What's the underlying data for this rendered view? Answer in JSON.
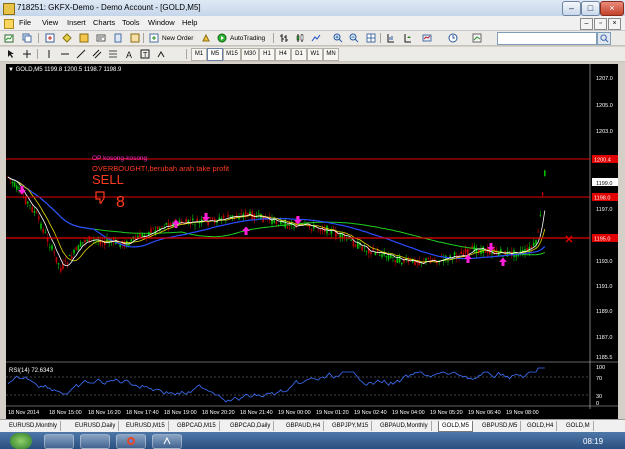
{
  "window": {
    "title": "718251: GKFX-Demo - Demo Account - [GOLD,M5]",
    "min": "–",
    "max": "□",
    "close": "×"
  },
  "menu": {
    "items": [
      "File",
      "View",
      "Insert",
      "Charts",
      "Tools",
      "Window",
      "Help"
    ],
    "mdi_min": "–",
    "mdi_restore": "▫",
    "mdi_close": "×"
  },
  "toolbar": {
    "new_order": "New Order",
    "auto_trading": "AutoTrading",
    "timeframes": [
      "M1",
      "M5",
      "M15",
      "M30",
      "H1",
      "H4",
      "D1",
      "W1",
      "MN"
    ],
    "active_timeframe": "M5",
    "search_placeholder": ""
  },
  "chart": {
    "header": "▼ GOLD,M5  1199.8 1200.5 1198.7 1198.9",
    "price_labels": [
      "1207.0",
      "1205.0",
      "1203.0",
      "1201.0",
      "1199.0",
      "1197.0",
      "1195.0",
      "1193.0",
      "1191.0",
      "1189.0",
      "1187.0",
      "1185.5"
    ],
    "price_markers": {
      "level1": "1200.4",
      "level2": "1198.0",
      "level3": "1195.0"
    },
    "annotations": {
      "op": "OP kosong-kosong",
      "overbought": "OVERBOUGHT!,berubah arah take profit",
      "sell": "SELL",
      "number": "8"
    },
    "rsi_label": "RSI(14) 72.6343",
    "rsi_levels": [
      "100",
      "70",
      "30",
      "0"
    ],
    "time_labels": [
      "18 Nov 2014",
      "18 Nov 15:00",
      "18 Nov 16:20",
      "18 Nov 17:40",
      "18 Nov 19:00",
      "18 Nov 20:20",
      "18 Nov 21:40",
      "19 Nov 00:00",
      "19 Nov 01:20",
      "19 Nov 02:40",
      "19 Nov 04:00",
      "19 Nov 05:20",
      "19 Nov 06:40",
      "19 Nov 08:00"
    ],
    "colors": {
      "bg": "#000000",
      "up": "#00c000",
      "down": "#c00000",
      "red_line": "#e00000",
      "ma_blue": "#2a4cff",
      "ma_green": "#1fcf1f",
      "ma_yellow": "#e6d800",
      "ma_white": "#ffffff",
      "arrow": "#ff1fd8",
      "rsi": "#3d72ff"
    }
  },
  "tabs": [
    "EURUSD,Monthly",
    "EURUSD,Daily",
    "EURUSD,M15",
    "GBPCAD,M15",
    "GBPCAD,Daily",
    "GBPAUD,H4",
    "GBPJPY,M15",
    "GBPAUD,Monthly",
    "GOLD,M5",
    "GBPUSD,M5",
    "GOLD,H4",
    "GOLD,M"
  ],
  "active_tab": "GOLD,M5",
  "taskbar": {
    "clock": "08:19"
  }
}
